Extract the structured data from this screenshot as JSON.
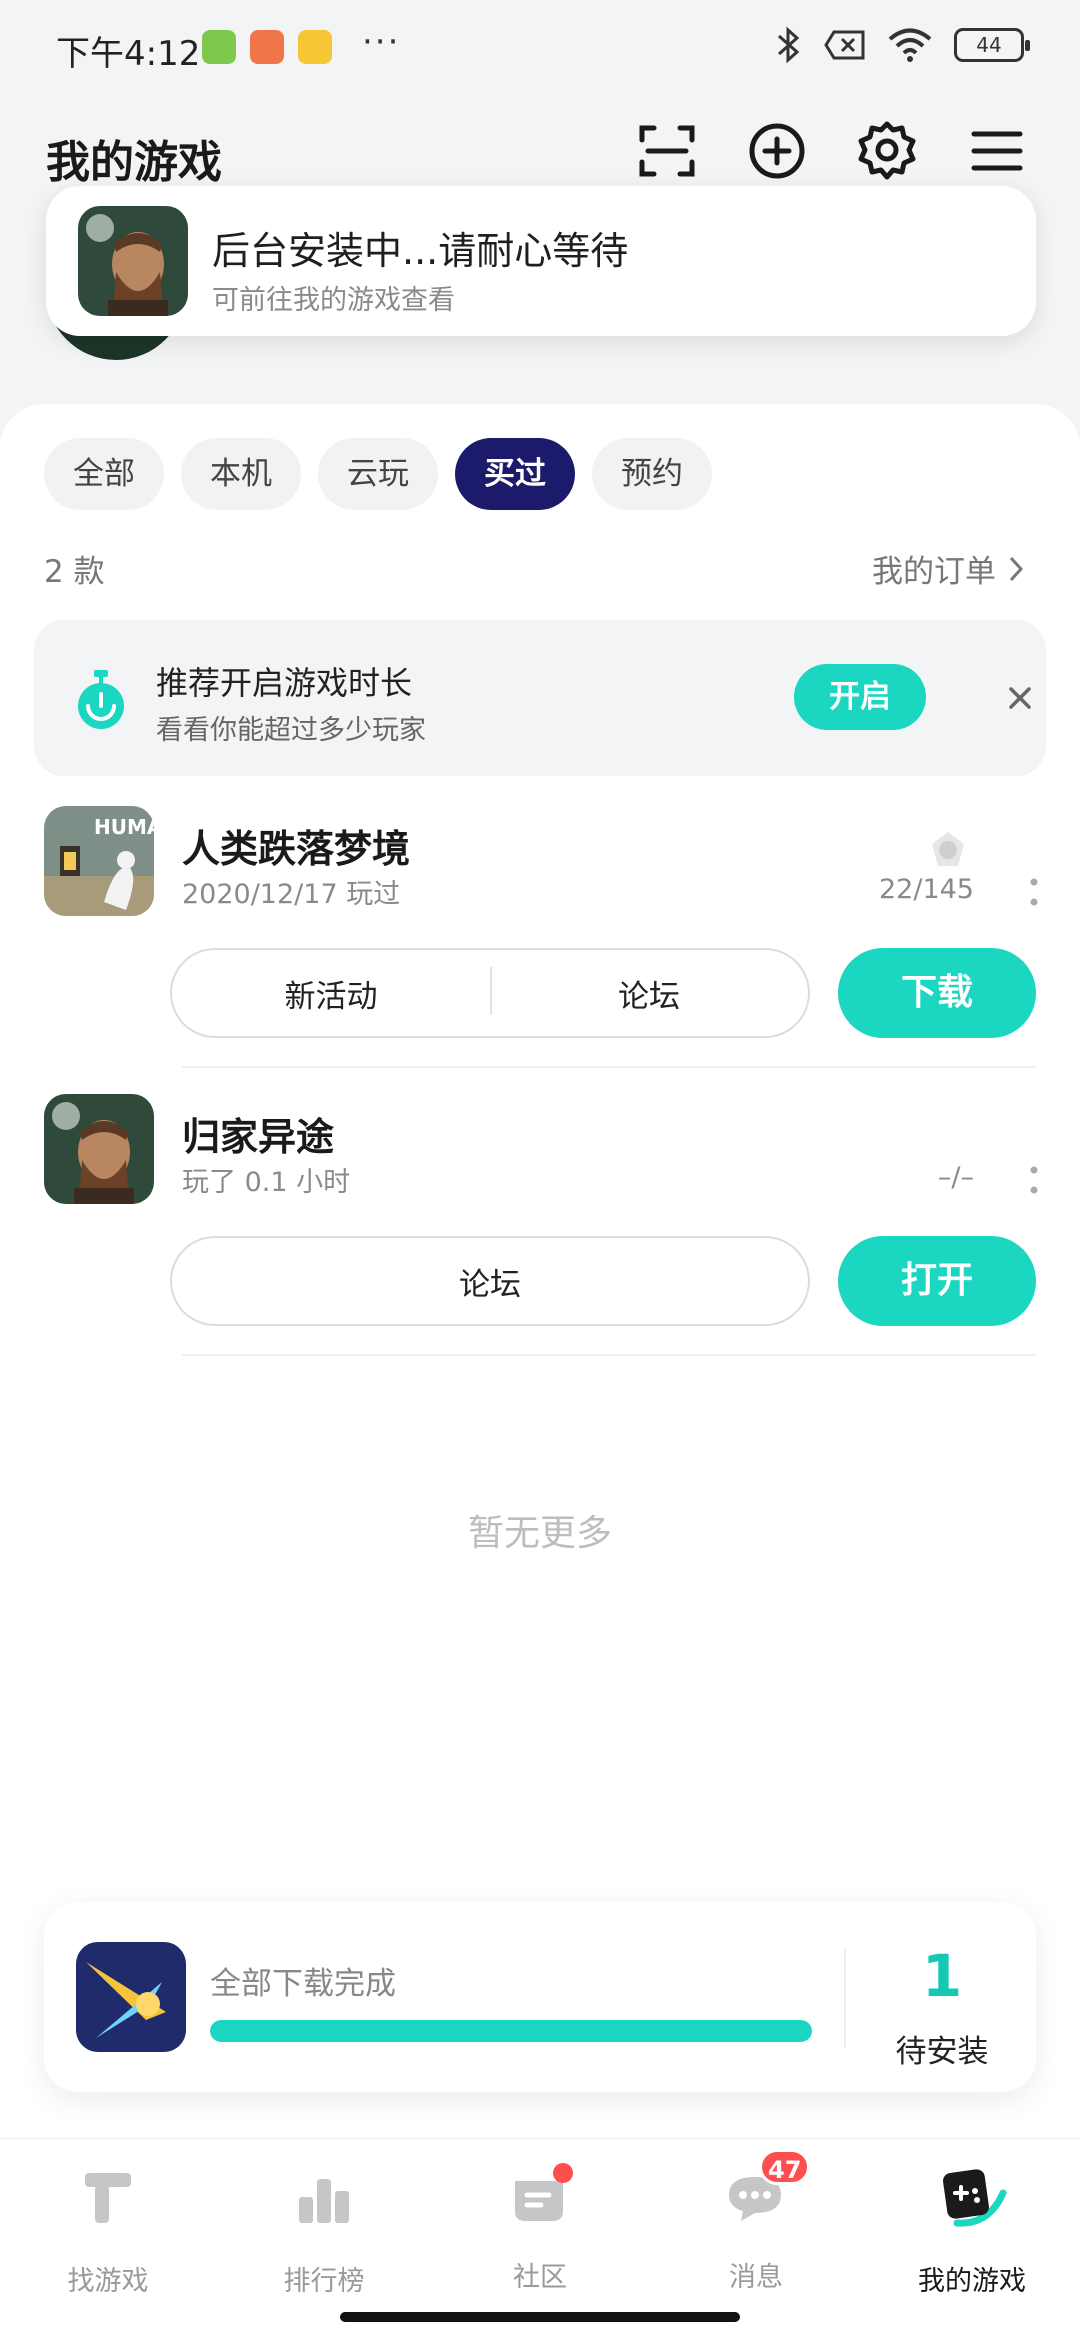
{
  "status_bar": {
    "time": "下午4:12",
    "battery": "44"
  },
  "header": {
    "title": "我的游戏"
  },
  "toast": {
    "title": "后台安装中...请耐心等待",
    "subtitle": "可前往我的游戏查看"
  },
  "tabs": [
    {
      "label": "全部",
      "active": false
    },
    {
      "label": "本机",
      "active": false
    },
    {
      "label": "云玩",
      "active": false
    },
    {
      "label": "买过",
      "active": true
    },
    {
      "label": "预约",
      "active": false
    }
  ],
  "list": {
    "count": "2 款",
    "orders_link": "我的订单"
  },
  "promo": {
    "title": "推荐开启游戏时长",
    "subtitle": "看看你能超过多少玩家",
    "button": "开启"
  },
  "games": [
    {
      "name": "人类跌落梦境",
      "subtitle": "2020/12/17 玩过",
      "achievements": "22/145",
      "pills": [
        "新活动",
        "论坛"
      ],
      "action": "下载"
    },
    {
      "name": "归家异途",
      "subtitle": "玩了 0.1 小时",
      "achievements": "–/–",
      "pills": [
        "论坛"
      ],
      "action": "打开"
    }
  ],
  "empty_text": "暂无更多",
  "download": {
    "title": "全部下载完成",
    "progress": 1.0,
    "pending_count": "1",
    "pending_label": "待安装"
  },
  "bottom_nav": [
    {
      "label": "找游戏",
      "icon": "find-game-icon"
    },
    {
      "label": "排行榜",
      "icon": "ranking-icon"
    },
    {
      "label": "社区",
      "icon": "community-icon"
    },
    {
      "label": "消息",
      "icon": "message-icon",
      "badge": "47"
    },
    {
      "label": "我的游戏",
      "icon": "my-games-icon",
      "active": true
    }
  ],
  "colors": {
    "accent": "#1bd6c0",
    "tab_active": "#1c1a6b",
    "badge": "#ff4e4e"
  }
}
